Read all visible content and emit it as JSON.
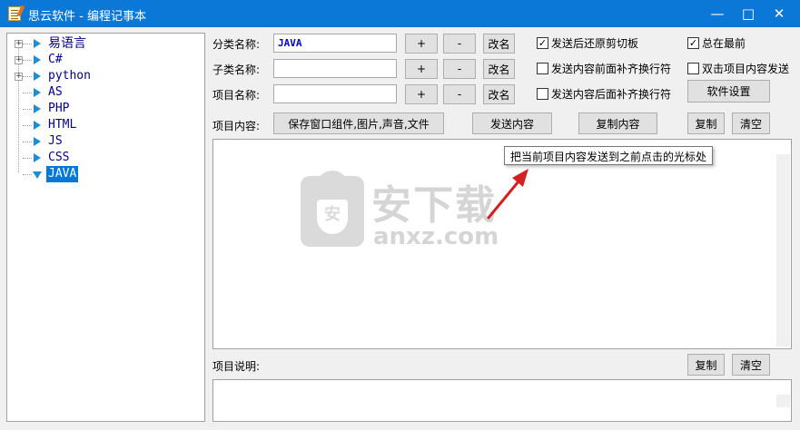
{
  "window": {
    "title": "思云软件 - 编程记事本",
    "minimize_glyph": "—",
    "maximize_glyph": "□",
    "close_glyph": "✕"
  },
  "tree": {
    "expander_glyph": "+",
    "items": [
      {
        "label": "易语言",
        "expandable": true,
        "selected": false
      },
      {
        "label": "C#",
        "expandable": true,
        "selected": false
      },
      {
        "label": "python",
        "expandable": true,
        "selected": false
      },
      {
        "label": "AS",
        "expandable": false,
        "selected": false
      },
      {
        "label": "PHP",
        "expandable": false,
        "selected": false
      },
      {
        "label": "HTML",
        "expandable": false,
        "selected": false
      },
      {
        "label": "JS",
        "expandable": false,
        "selected": false
      },
      {
        "label": "CSS",
        "expandable": false,
        "selected": false
      },
      {
        "label": "JAVA",
        "expandable": false,
        "selected": true
      }
    ]
  },
  "form": {
    "category_label": "分类名称:",
    "category_value": "JAVA",
    "subcategory_label": "子类名称:",
    "subcategory_value": "",
    "item_label": "项目名称:",
    "item_value": "",
    "add_glyph": "+",
    "remove_glyph": "-",
    "rename_label": "改名",
    "content_label": "项目内容:",
    "save_components_label": "保存窗口组件,图片,声音,文件",
    "send_content_label": "发送内容",
    "copy_content_label": "复制内容",
    "copy_label": "复制",
    "clear_label": "清空",
    "settings_label": "软件设置",
    "description_label": "项目说明:",
    "desc_copy_label": "复制",
    "desc_clear_label": "清空"
  },
  "options": {
    "restore_clipboard": {
      "label": "发送后还原剪切板",
      "checked": true
    },
    "always_on_top": {
      "label": "总在最前",
      "checked": true
    },
    "prefix_newline": {
      "label": "发送内容前面补齐换行符",
      "checked": false
    },
    "doubleclick_send": {
      "label": "双击项目内容发送",
      "checked": false
    },
    "suffix_newline": {
      "label": "发送内容后面补齐换行符",
      "checked": false
    },
    "check_glyph": "✓"
  },
  "tooltip": {
    "text": "把当前项目内容发送到之前点击的光标处"
  },
  "watermark": {
    "badge": "安",
    "title": "安下载",
    "subtitle": "anxz.com"
  },
  "colors": {
    "titlebar": "#0b78d7",
    "tree_selection": "#0078d7",
    "arrow": "#d42020"
  }
}
